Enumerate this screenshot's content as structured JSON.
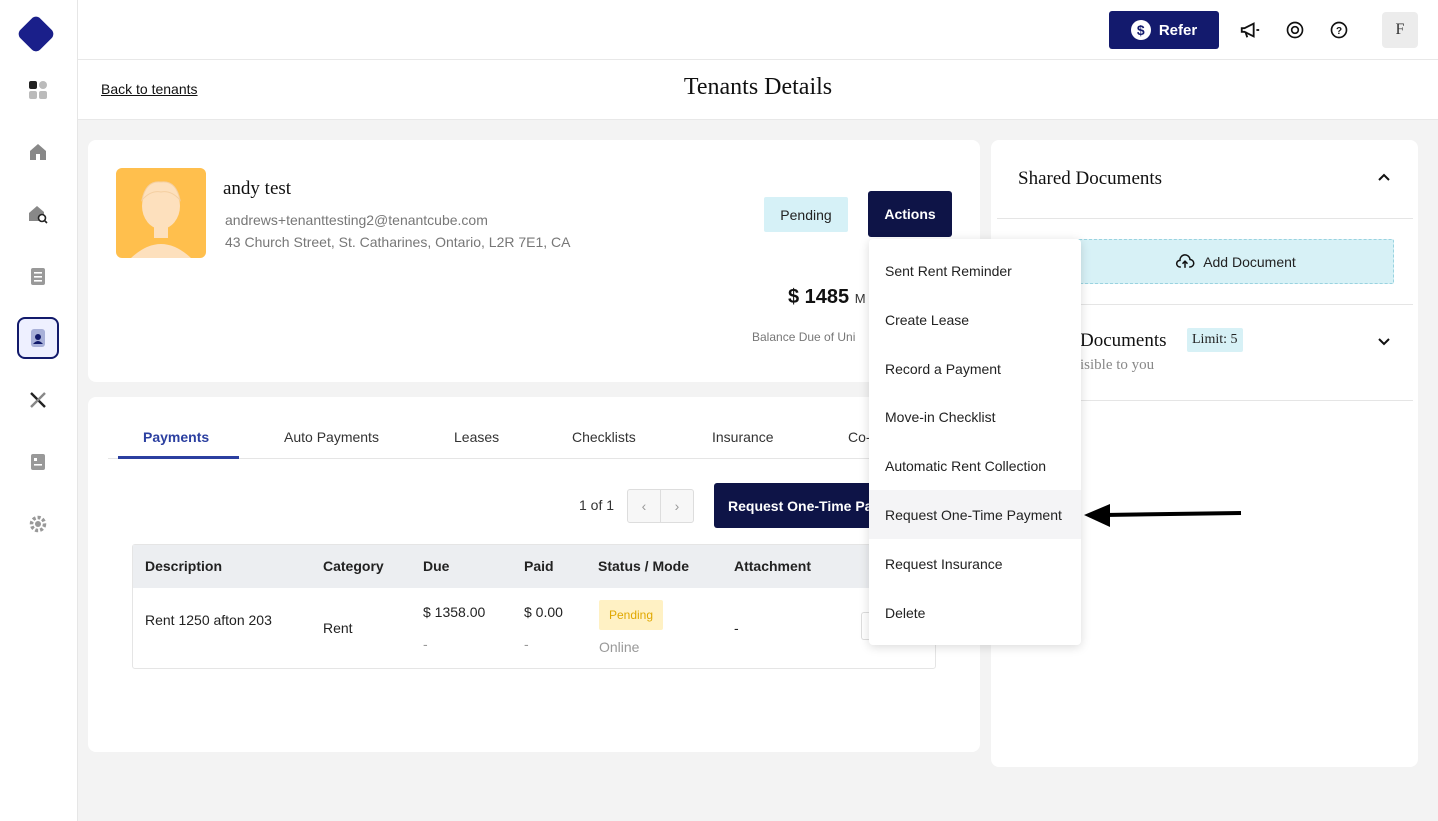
{
  "sidebar": {
    "items": [
      {
        "name": "dashboard",
        "icon": "grid-icon"
      },
      {
        "name": "properties",
        "icon": "house-icon"
      },
      {
        "name": "listings",
        "icon": "house-search-icon"
      },
      {
        "name": "applications",
        "icon": "clipboard-icon"
      },
      {
        "name": "tenants",
        "icon": "tenant-icon",
        "active": true
      },
      {
        "name": "maintenance",
        "icon": "tools-icon"
      },
      {
        "name": "accounting",
        "icon": "ledger-icon"
      },
      {
        "name": "settings",
        "icon": "gear-icon"
      }
    ]
  },
  "topbar": {
    "refer_label": "Refer",
    "refer_symbol": "$",
    "user_initial": "F"
  },
  "header": {
    "back_label": "Back to tenants",
    "title": "Tenants Details"
  },
  "tenant": {
    "name": "andy test",
    "email": "andrews+tenanttesting2@tenantcube.com",
    "address": "43 Church Street, St. Catharines, Ontario, L2R 7E1, CA",
    "status": "Pending",
    "actions_label": "Actions",
    "amount": "$ 1485",
    "amount_suffix": "M",
    "balance_label": "Balance Due of Uni"
  },
  "actions_menu": {
    "items": [
      "Sent Rent Reminder",
      "Create Lease",
      "Record a Payment",
      "Move-in Checklist",
      "Automatic Rent Collection",
      "Request One-Time Payment",
      "Request Insurance",
      "Delete"
    ],
    "highlighted": "Request One-Time Payment"
  },
  "tabs": {
    "items": [
      "Payments",
      "Auto Payments",
      "Leases",
      "Checklists",
      "Insurance",
      "Co-"
    ],
    "active": "Payments"
  },
  "payments": {
    "pager_text": "1 of 1",
    "prev_symbol": "‹",
    "next_symbol": "›",
    "request_button": "Request One-Time Pa",
    "columns": [
      "Description",
      "Category",
      "Due",
      "Paid",
      "Status / Mode",
      "Attachment"
    ],
    "rows": [
      {
        "description": "Rent 1250 afton 203",
        "category": "Rent",
        "due": "$ 1358.00",
        "due_sub": "-",
        "paid": "$ 0.00",
        "paid_sub": "-",
        "status": "Pending",
        "mode": "Online",
        "attachment": "-"
      }
    ]
  },
  "documents": {
    "shared_title": "Shared Documents",
    "add_label": "Add Document",
    "second_title": "Documents",
    "limit_label": "Limit: 5",
    "second_sub": "isible to you"
  },
  "colors": {
    "primary": "#0e1447",
    "accent": "#2b3fa0",
    "badge_bg": "#d6f1f7",
    "pending_bg": "#fff1c4",
    "pending_text": "#e0a800",
    "avatar_bg": "#ffbf4d"
  }
}
